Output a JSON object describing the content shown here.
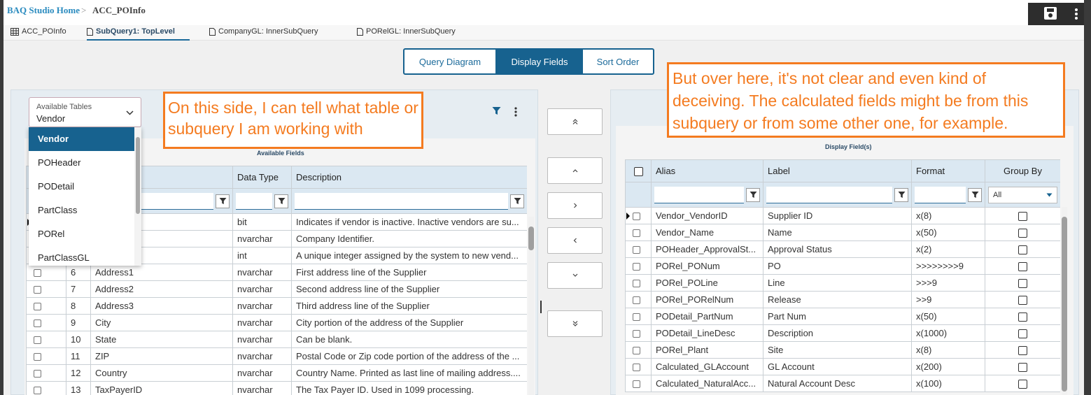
{
  "breadcrumb": {
    "home": "BAQ Studio Home",
    "separator": ">",
    "current": "ACC_POInfo"
  },
  "tabs": [
    {
      "label": "ACC_POInfo",
      "icon": "grid-icon"
    },
    {
      "label": "SubQuery1: TopLevel",
      "icon": "document-icon",
      "active": true
    },
    {
      "label": "CompanyGL: InnerSubQuery",
      "icon": "document-icon"
    },
    {
      "label": "PORelGL: InnerSubQuery",
      "icon": "document-icon"
    }
  ],
  "segmented": [
    "Query Diagram",
    "Display Fields",
    "Sort Order"
  ],
  "segmented_active": "Display Fields",
  "available_tables": {
    "label": "Available Tables",
    "value": "Vendor",
    "options": [
      "Vendor",
      "POHeader",
      "PODetail",
      "PartClass",
      "PORel",
      "PartClassGL"
    ]
  },
  "available_fields": {
    "caption": "Available Fields",
    "columns": [
      "Data Type",
      "Description"
    ],
    "rows": [
      {
        "num": "",
        "name": "",
        "type": "bit",
        "desc": "Indicates if vendor is inactive. Inactive vendors are su..."
      },
      {
        "num": "",
        "name": "",
        "type": "nvarchar",
        "desc": "Company Identifier."
      },
      {
        "num": "",
        "name": "",
        "type": "int",
        "desc": "A unique integer assigned by the system to new vend..."
      },
      {
        "num": "6",
        "name": "Address1",
        "type": "nvarchar",
        "desc": "First address line of the Supplier"
      },
      {
        "num": "7",
        "name": "Address2",
        "type": "nvarchar",
        "desc": "Second address line of the Supplier"
      },
      {
        "num": "8",
        "name": "Address3",
        "type": "nvarchar",
        "desc": "Third address line of the Supplier"
      },
      {
        "num": "9",
        "name": "City",
        "type": "nvarchar",
        "desc": "City portion of the address of the Supplier"
      },
      {
        "num": "10",
        "name": "State",
        "type": "nvarchar",
        "desc": "Can be blank."
      },
      {
        "num": "11",
        "name": "ZIP",
        "type": "nvarchar",
        "desc": "Postal Code or Zip code portion of the address of the ..."
      },
      {
        "num": "12",
        "name": "Country",
        "type": "nvarchar",
        "desc": "Country Name. Printed as last line of mailing address...."
      },
      {
        "num": "13",
        "name": "TaxPayerID",
        "type": "nvarchar",
        "desc": "The Tax Payer ID. Used in 1099 processing."
      }
    ]
  },
  "display_fields": {
    "caption": "Display Field(s)",
    "columns": [
      "Alias",
      "Label",
      "Format",
      "Group By"
    ],
    "group_filter": "All",
    "rows": [
      {
        "alias": "Vendor_VendorID",
        "label": "Supplier ID",
        "format": "x(8)"
      },
      {
        "alias": "Vendor_Name",
        "label": "Name",
        "format": "x(50)"
      },
      {
        "alias": "POHeader_ApprovalSt...",
        "label": "Approval Status",
        "format": "x(2)"
      },
      {
        "alias": "PORel_PONum",
        "label": "PO",
        "format": ">>>>>>>>9"
      },
      {
        "alias": "PORel_POLine",
        "label": "Line",
        "format": ">>>9"
      },
      {
        "alias": "PORel_PORelNum",
        "label": "Release",
        "format": ">>9"
      },
      {
        "alias": "PODetail_PartNum",
        "label": "Part Num",
        "format": "x(50)"
      },
      {
        "alias": "PODetail_LineDesc",
        "label": "Description",
        "format": "x(1000)"
      },
      {
        "alias": "PORel_Plant",
        "label": "Site",
        "format": "x(8)"
      },
      {
        "alias": "Calculated_GLAccount",
        "label": "GL Account",
        "format": "x(200)"
      },
      {
        "alias": "Calculated_NaturalAcc...",
        "label": "Natural Account Desc",
        "format": "x(100)"
      }
    ]
  },
  "callouts": {
    "left": "On this side, I can tell what table or subquery I am working with",
    "right": "But over here, it's not clear and even kind of deceiving. The calculated fields might be from this subquery or from some other one, for example."
  },
  "colors": {
    "accent": "#17628f",
    "link": "#2a8bbf",
    "callout": "#f47b20",
    "header": "#dbe8f2"
  }
}
